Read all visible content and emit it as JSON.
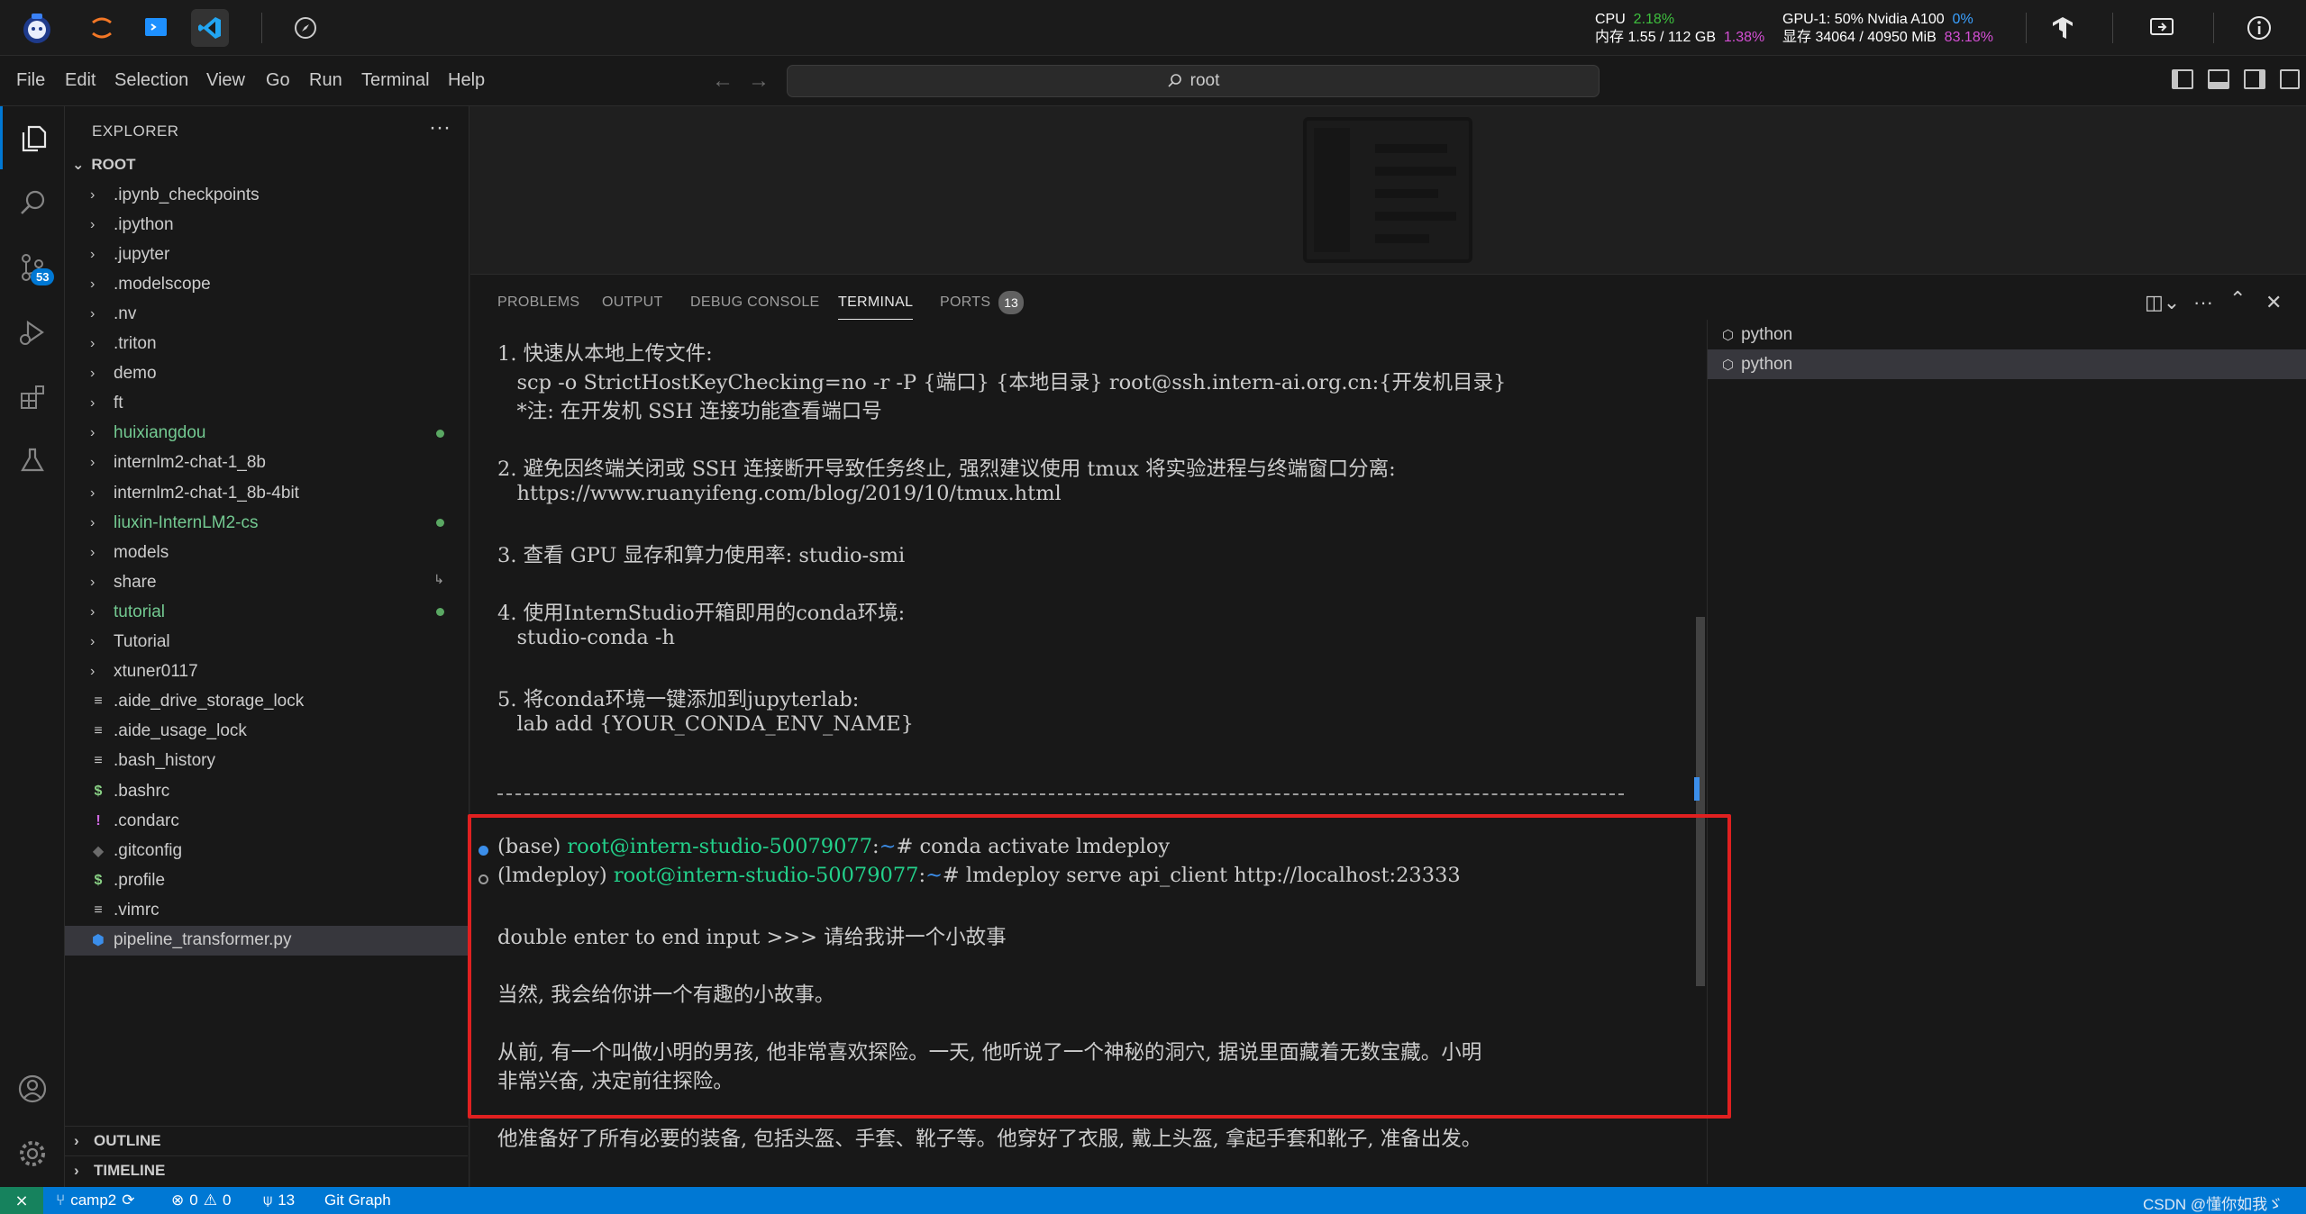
{
  "topbar": {
    "cpu_label": "CPU",
    "cpu_value": "2.18%",
    "mem_label": "内存 1.55 / 112 GB",
    "mem_value": "1.38%",
    "gpu_label": "GPU-1: 50% Nvidia A100",
    "gpu_value": "0%",
    "vram_label": "显存 34064 / 40950 MiB",
    "vram_value": "83.18%"
  },
  "menu": {
    "items": [
      "File",
      "Edit",
      "Selection",
      "View",
      "Go",
      "Run",
      "Terminal",
      "Help"
    ],
    "search_text": "root"
  },
  "activity": {
    "scm_badge": "53"
  },
  "explorer": {
    "title": "EXPLORER",
    "more": "···",
    "root_label": "ROOT",
    "items": [
      {
        "label": ".ipynb_checkpoints",
        "type": "folder"
      },
      {
        "label": ".ipython",
        "type": "folder"
      },
      {
        "label": ".jupyter",
        "type": "folder"
      },
      {
        "label": ".modelscope",
        "type": "folder"
      },
      {
        "label": ".nv",
        "type": "folder"
      },
      {
        "label": ".triton",
        "type": "folder"
      },
      {
        "label": "demo",
        "type": "folder"
      },
      {
        "label": "ft",
        "type": "folder"
      },
      {
        "label": "huixiangdou",
        "type": "folder",
        "status": "modified"
      },
      {
        "label": "internlm2-chat-1_8b",
        "type": "folder"
      },
      {
        "label": "internlm2-chat-1_8b-4bit",
        "type": "folder"
      },
      {
        "label": "liuxin-InternLM2-cs",
        "type": "folder",
        "status": "modified"
      },
      {
        "label": "models",
        "type": "folder"
      },
      {
        "label": "share",
        "type": "folder",
        "status": "link"
      },
      {
        "label": "tutorial",
        "type": "folder",
        "status": "modified"
      },
      {
        "label": "Tutorial",
        "type": "folder"
      },
      {
        "label": "xtuner0117",
        "type": "folder"
      },
      {
        "label": ".aide_drive_storage_lock",
        "type": "file",
        "icon": "≡"
      },
      {
        "label": ".aide_usage_lock",
        "type": "file",
        "icon": "≡"
      },
      {
        "label": ".bash_history",
        "type": "file",
        "icon": "≡"
      },
      {
        "label": ".bashrc",
        "type": "file",
        "icon": "$"
      },
      {
        "label": ".condarc",
        "type": "file",
        "icon": "!"
      },
      {
        "label": ".gitconfig",
        "type": "file",
        "icon": "◆"
      },
      {
        "label": ".profile",
        "type": "file",
        "icon": "$"
      },
      {
        "label": ".vimrc",
        "type": "file",
        "icon": "≡"
      },
      {
        "label": "pipeline_transformer.py",
        "type": "file",
        "icon": "py",
        "selected": true
      }
    ],
    "outline_label": "OUTLINE",
    "timeline_label": "TIMELINE"
  },
  "panel": {
    "tabs": [
      "PROBLEMS",
      "OUTPUT",
      "DEBUG CONSOLE",
      "TERMINAL",
      "PORTS"
    ],
    "active_tab": "TERMINAL",
    "ports_count": "13",
    "terminals": [
      "python",
      "python"
    ]
  },
  "terminal": {
    "lines": [
      "1. 快速从本地上传文件:",
      "   scp -o StrictHostKeyChecking=no -r -P {端口} {本地目录} root@ssh.intern-ai.org.cn:{开发机目录}",
      "   *注: 在开发机 SSH 连接功能查看端口号",
      "",
      "2. 避免因终端关闭或 SSH 连接断开导致任务终止, 强烈建议使用 tmux 将实验进程与终端窗口分离:",
      "   https://www.ruanyifeng.com/blog/2019/10/tmux.html",
      "",
      "3. 查看 GPU 显存和算力使用率: studio-smi",
      "",
      "4. 使用InternStudio开箱即用的conda环境:",
      "   studio-conda -h",
      "",
      "5. 将conda环境一键添加到jupyterlab:",
      "   lab add {YOUR_CONDA_ENV_NAME}"
    ],
    "prompt1_env": "(base) ",
    "prompt1_user": "root@intern-studio-50079077",
    "prompt1_path": "~",
    "prompt1_cmd": "# conda activate lmdeploy",
    "prompt2_env": "(lmdeploy) ",
    "prompt2_user": "root@intern-studio-50079077",
    "prompt2_path": "~",
    "prompt2_cmd": "# lmdeploy serve api_client http://localhost:23333",
    "input_line": "double enter to end input >>> 请给我讲一个小故事",
    "answer_1": "当然, 我会给你讲一个有趣的小故事。",
    "answer_2": "从前, 有一个叫做小明的男孩, 他非常喜欢探险。一天, 他听说了一个神秘的洞穴, 据说里面藏着无数宝藏。小明",
    "answer_3": "非常兴奋, 决定前往探险。",
    "answer_4": "他准备好了所有必要的装备, 包括头盔、手套、靴子等。他穿好了衣服, 戴上头盔, 拿起手套和靴子, 准备出发。"
  },
  "statusbar": {
    "branch": "camp2",
    "errors": "0",
    "warnings": "0",
    "ports": "13",
    "git_graph": "Git Graph",
    "watermark": "CSDN @懂你如我ゞ"
  },
  "colors": {
    "accent": "#0078d4",
    "highlight_box": "#e02020",
    "prompt_user": "#23d18b",
    "prompt_path": "#3b8eea"
  }
}
